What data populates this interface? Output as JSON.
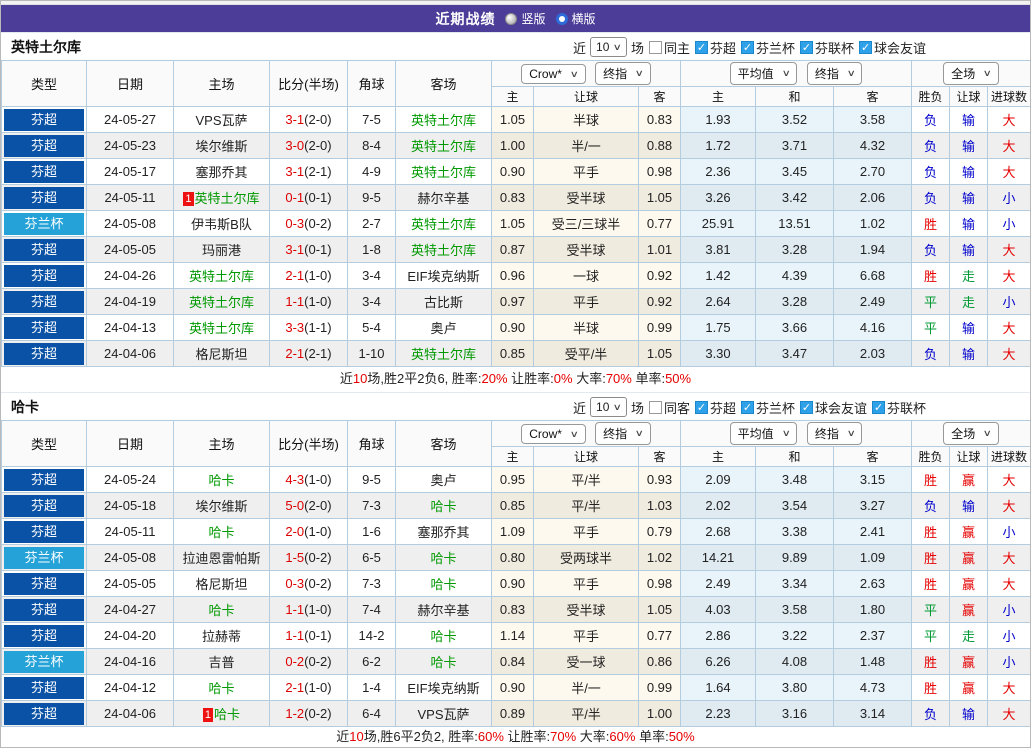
{
  "topbar": {
    "title": "近期战绩",
    "vertical_label": "竖版",
    "horizontal_label": "横版"
  },
  "icons": {
    "chevron_down": "∨",
    "check": "✓"
  },
  "colors": {
    "accent_purple": "#4c3d99",
    "league_colors": {
      "芬超": "#0a52a5",
      "芬兰杯": "#25a3d8"
    },
    "result_colors": {
      "胜": "#e60000",
      "赢": "#e60000",
      "大": "#e60000",
      "负": "#0000cd",
      "输": "#0000cd",
      "小": "#0000cd",
      "平": "#009933",
      "走": "#009933"
    },
    "highlight_team_green": "#009900",
    "score_red": "#dd0000"
  },
  "table_headers": {
    "main": [
      "类型",
      "日期",
      "主场",
      "比分(半场)",
      "角球",
      "客场"
    ],
    "dropdowns": {
      "book": "Crow*",
      "book_ref": "终指",
      "avg": "平均值",
      "avg_ref": "终指",
      "fulltime": "全场"
    },
    "sub": [
      "主",
      "让球",
      "客",
      "主",
      "和",
      "客",
      "胜负",
      "让球",
      "进球数"
    ]
  },
  "sections": [
    {
      "team": "英特土尔库",
      "filters": {
        "near": "近",
        "count": "10",
        "games": "场",
        "same": "同主",
        "leagues": [
          "芬超",
          "芬兰杯",
          "芬联杯",
          "球会友谊"
        ]
      },
      "rows": [
        {
          "league": "芬超",
          "date": "24-05-27",
          "home": "VPS瓦萨",
          "home_hl": false,
          "home_mark": false,
          "score": "3-1",
          "half": "2-0",
          "corner": "7-5",
          "away": "英特土尔库",
          "away_hl": true,
          "h_odds": "1.05",
          "handicap": "半球",
          "a_odds": "0.83",
          "avg_h": "1.93",
          "avg_d": "3.52",
          "avg_a": "3.58",
          "r_match": "负",
          "r_handicap": "输",
          "r_goals": "大"
        },
        {
          "league": "芬超",
          "date": "24-05-23",
          "home": "埃尔维斯",
          "home_hl": false,
          "home_mark": false,
          "score": "3-0",
          "half": "2-0",
          "corner": "8-4",
          "away": "英特土尔库",
          "away_hl": true,
          "h_odds": "1.00",
          "handicap": "半/一",
          "a_odds": "0.88",
          "avg_h": "1.72",
          "avg_d": "3.71",
          "avg_a": "4.32",
          "r_match": "负",
          "r_handicap": "输",
          "r_goals": "大"
        },
        {
          "league": "芬超",
          "date": "24-05-17",
          "home": "塞那乔其",
          "home_hl": false,
          "home_mark": false,
          "score": "3-1",
          "half": "2-1",
          "corner": "4-9",
          "away": "英特土尔库",
          "away_hl": true,
          "h_odds": "0.90",
          "handicap": "平手",
          "a_odds": "0.98",
          "avg_h": "2.36",
          "avg_d": "3.45",
          "avg_a": "2.70",
          "r_match": "负",
          "r_handicap": "输",
          "r_goals": "大"
        },
        {
          "league": "芬超",
          "date": "24-05-11",
          "home": "英特土尔库",
          "home_hl": true,
          "home_mark": true,
          "score": "0-1",
          "half": "0-1",
          "corner": "9-5",
          "away": "赫尔辛基",
          "away_hl": false,
          "h_odds": "0.83",
          "handicap": "受半球",
          "a_odds": "1.05",
          "avg_h": "3.26",
          "avg_d": "3.42",
          "avg_a": "2.06",
          "r_match": "负",
          "r_handicap": "输",
          "r_goals": "小"
        },
        {
          "league": "芬兰杯",
          "date": "24-05-08",
          "home": "伊韦斯B队",
          "home_hl": false,
          "home_mark": false,
          "score": "0-3",
          "half": "0-2",
          "corner": "2-7",
          "away": "英特土尔库",
          "away_hl": true,
          "h_odds": "1.05",
          "handicap": "受三/三球半",
          "a_odds": "0.77",
          "avg_h": "25.91",
          "avg_d": "13.51",
          "avg_a": "1.02",
          "r_match": "胜",
          "r_handicap": "输",
          "r_goals": "小"
        },
        {
          "league": "芬超",
          "date": "24-05-05",
          "home": "玛丽港",
          "home_hl": false,
          "home_mark": false,
          "score": "3-1",
          "half": "0-1",
          "corner": "1-8",
          "away": "英特土尔库",
          "away_hl": true,
          "h_odds": "0.87",
          "handicap": "受半球",
          "a_odds": "1.01",
          "avg_h": "3.81",
          "avg_d": "3.28",
          "avg_a": "1.94",
          "r_match": "负",
          "r_handicap": "输",
          "r_goals": "大"
        },
        {
          "league": "芬超",
          "date": "24-04-26",
          "home": "英特土尔库",
          "home_hl": true,
          "home_mark": false,
          "score": "2-1",
          "half": "1-0",
          "corner": "3-4",
          "away": "EIF埃克纳斯",
          "away_hl": false,
          "h_odds": "0.96",
          "handicap": "一球",
          "a_odds": "0.92",
          "avg_h": "1.42",
          "avg_d": "4.39",
          "avg_a": "6.68",
          "r_match": "胜",
          "r_handicap": "走",
          "r_goals": "大"
        },
        {
          "league": "芬超",
          "date": "24-04-19",
          "home": "英特土尔库",
          "home_hl": true,
          "home_mark": false,
          "score": "1-1",
          "half": "1-0",
          "corner": "3-4",
          "away": "古比斯",
          "away_hl": false,
          "h_odds": "0.97",
          "handicap": "平手",
          "a_odds": "0.92",
          "avg_h": "2.64",
          "avg_d": "3.28",
          "avg_a": "2.49",
          "r_match": "平",
          "r_handicap": "走",
          "r_goals": "小"
        },
        {
          "league": "芬超",
          "date": "24-04-13",
          "home": "英特土尔库",
          "home_hl": true,
          "home_mark": false,
          "score": "3-3",
          "half": "1-1",
          "corner": "5-4",
          "away": "奥卢",
          "away_hl": false,
          "h_odds": "0.90",
          "handicap": "半球",
          "a_odds": "0.99",
          "avg_h": "1.75",
          "avg_d": "3.66",
          "avg_a": "4.16",
          "r_match": "平",
          "r_handicap": "输",
          "r_goals": "大"
        },
        {
          "league": "芬超",
          "date": "24-04-06",
          "home": "格尼斯坦",
          "home_hl": false,
          "home_mark": false,
          "score": "2-1",
          "half": "2-1",
          "corner": "1-10",
          "away": "英特土尔库",
          "away_hl": true,
          "h_odds": "0.85",
          "handicap": "受平/半",
          "a_odds": "1.05",
          "avg_h": "3.30",
          "avg_d": "3.47",
          "avg_a": "2.03",
          "r_match": "负",
          "r_handicap": "输",
          "r_goals": "大"
        }
      ],
      "summary": [
        {
          "text": "近",
          "red": false
        },
        {
          "text": "10",
          "red": true
        },
        {
          "text": "场,胜2平2负6, 胜率:",
          "red": false
        },
        {
          "text": "20%",
          "red": true
        },
        {
          "text": " 让胜率:",
          "red": false
        },
        {
          "text": "0%",
          "red": true
        },
        {
          "text": " 大率:",
          "red": false
        },
        {
          "text": "70%",
          "red": true
        },
        {
          "text": " 单率:",
          "red": false
        },
        {
          "text": "50%",
          "red": true
        }
      ]
    },
    {
      "team": "哈卡",
      "filters": {
        "near": "近",
        "count": "10",
        "games": "场",
        "same": "同客",
        "leagues": [
          "芬超",
          "芬兰杯",
          "球会友谊",
          "芬联杯"
        ]
      },
      "rows": [
        {
          "league": "芬超",
          "date": "24-05-24",
          "home": "哈卡",
          "home_hl": true,
          "home_mark": false,
          "score": "4-3",
          "half": "1-0",
          "corner": "9-5",
          "away": "奥卢",
          "away_hl": false,
          "h_odds": "0.95",
          "handicap": "平/半",
          "a_odds": "0.93",
          "avg_h": "2.09",
          "avg_d": "3.48",
          "avg_a": "3.15",
          "r_match": "胜",
          "r_handicap": "赢",
          "r_goals": "大"
        },
        {
          "league": "芬超",
          "date": "24-05-18",
          "home": "埃尔维斯",
          "home_hl": false,
          "home_mark": false,
          "score": "5-0",
          "half": "2-0",
          "corner": "7-3",
          "away": "哈卡",
          "away_hl": true,
          "h_odds": "0.85",
          "handicap": "平/半",
          "a_odds": "1.03",
          "avg_h": "2.02",
          "avg_d": "3.54",
          "avg_a": "3.27",
          "r_match": "负",
          "r_handicap": "输",
          "r_goals": "大"
        },
        {
          "league": "芬超",
          "date": "24-05-11",
          "home": "哈卡",
          "home_hl": true,
          "home_mark": false,
          "score": "2-0",
          "half": "1-0",
          "corner": "1-6",
          "away": "塞那乔其",
          "away_hl": false,
          "h_odds": "1.09",
          "handicap": "平手",
          "a_odds": "0.79",
          "avg_h": "2.68",
          "avg_d": "3.38",
          "avg_a": "2.41",
          "r_match": "胜",
          "r_handicap": "赢",
          "r_goals": "小"
        },
        {
          "league": "芬兰杯",
          "date": "24-05-08",
          "home": "拉迪恩雷帕斯",
          "home_hl": false,
          "home_mark": false,
          "score": "1-5",
          "half": "0-2",
          "corner": "6-5",
          "away": "哈卡",
          "away_hl": true,
          "h_odds": "0.80",
          "handicap": "受两球半",
          "a_odds": "1.02",
          "avg_h": "14.21",
          "avg_d": "9.89",
          "avg_a": "1.09",
          "r_match": "胜",
          "r_handicap": "赢",
          "r_goals": "大"
        },
        {
          "league": "芬超",
          "date": "24-05-05",
          "home": "格尼斯坦",
          "home_hl": false,
          "home_mark": false,
          "score": "0-3",
          "half": "0-2",
          "corner": "7-3",
          "away": "哈卡",
          "away_hl": true,
          "h_odds": "0.90",
          "handicap": "平手",
          "a_odds": "0.98",
          "avg_h": "2.49",
          "avg_d": "3.34",
          "avg_a": "2.63",
          "r_match": "胜",
          "r_handicap": "赢",
          "r_goals": "大"
        },
        {
          "league": "芬超",
          "date": "24-04-27",
          "home": "哈卡",
          "home_hl": true,
          "home_mark": false,
          "score": "1-1",
          "half": "1-0",
          "corner": "7-4",
          "away": "赫尔辛基",
          "away_hl": false,
          "h_odds": "0.83",
          "handicap": "受半球",
          "a_odds": "1.05",
          "avg_h": "4.03",
          "avg_d": "3.58",
          "avg_a": "1.80",
          "r_match": "平",
          "r_handicap": "赢",
          "r_goals": "小"
        },
        {
          "league": "芬超",
          "date": "24-04-20",
          "home": "拉赫蒂",
          "home_hl": false,
          "home_mark": false,
          "score": "1-1",
          "half": "0-1",
          "corner": "14-2",
          "away": "哈卡",
          "away_hl": true,
          "h_odds": "1.14",
          "handicap": "平手",
          "a_odds": "0.77",
          "avg_h": "2.86",
          "avg_d": "3.22",
          "avg_a": "2.37",
          "r_match": "平",
          "r_handicap": "走",
          "r_goals": "小"
        },
        {
          "league": "芬兰杯",
          "date": "24-04-16",
          "home": "吉普",
          "home_hl": false,
          "home_mark": false,
          "score": "0-2",
          "half": "0-2",
          "corner": "6-2",
          "away": "哈卡",
          "away_hl": true,
          "h_odds": "0.84",
          "handicap": "受一球",
          "a_odds": "0.86",
          "avg_h": "6.26",
          "avg_d": "4.08",
          "avg_a": "1.48",
          "r_match": "胜",
          "r_handicap": "赢",
          "r_goals": "小"
        },
        {
          "league": "芬超",
          "date": "24-04-12",
          "home": "哈卡",
          "home_hl": true,
          "home_mark": false,
          "score": "2-1",
          "half": "1-0",
          "corner": "1-4",
          "away": "EIF埃克纳斯",
          "away_hl": false,
          "h_odds": "0.90",
          "handicap": "半/一",
          "a_odds": "0.99",
          "avg_h": "1.64",
          "avg_d": "3.80",
          "avg_a": "4.73",
          "r_match": "胜",
          "r_handicap": "赢",
          "r_goals": "大"
        },
        {
          "league": "芬超",
          "date": "24-04-06",
          "home": "哈卡",
          "home_hl": true,
          "home_mark": true,
          "score": "1-2",
          "half": "0-2",
          "corner": "6-4",
          "away": "VPS瓦萨",
          "away_hl": false,
          "h_odds": "0.89",
          "handicap": "平/半",
          "a_odds": "1.00",
          "avg_h": "2.23",
          "avg_d": "3.16",
          "avg_a": "3.14",
          "r_match": "负",
          "r_handicap": "输",
          "r_goals": "大"
        }
      ],
      "summary": [
        {
          "text": "近",
          "red": false
        },
        {
          "text": "10",
          "red": true
        },
        {
          "text": "场,胜6平2负2, 胜率:",
          "red": false
        },
        {
          "text": "60%",
          "red": true
        },
        {
          "text": " 让胜率:",
          "red": false
        },
        {
          "text": "70%",
          "red": true
        },
        {
          "text": " 大率:",
          "red": false
        },
        {
          "text": "60%",
          "red": true
        },
        {
          "text": " 单率:",
          "red": false
        },
        {
          "text": "50%",
          "red": true
        }
      ]
    }
  ]
}
